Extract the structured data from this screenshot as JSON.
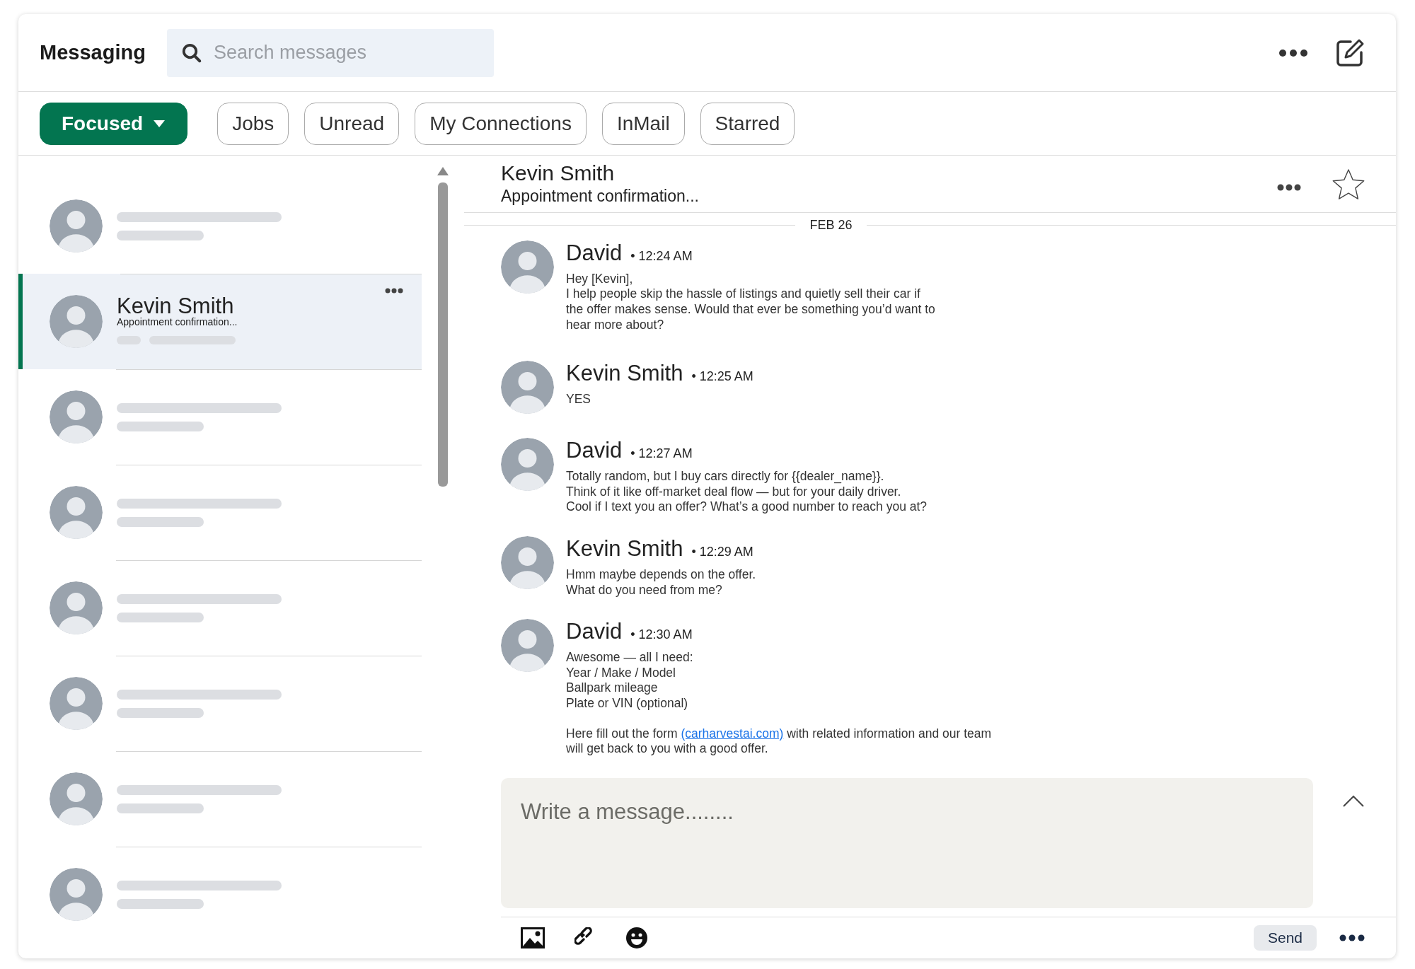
{
  "header": {
    "title": "Messaging",
    "search": {
      "placeholder": "Search messages"
    }
  },
  "filters": [
    {
      "label": "Focused",
      "kind": "dropdown",
      "selected": true
    },
    {
      "label": "Jobs",
      "kind": "pill",
      "selected": false
    },
    {
      "label": "Unread",
      "kind": "pill",
      "selected": false
    },
    {
      "label": "My Connections",
      "kind": "pill",
      "selected": false
    },
    {
      "label": "InMail",
      "kind": "pill",
      "selected": false
    },
    {
      "label": "Starred",
      "kind": "pill",
      "selected": false
    }
  ],
  "conversations": [
    {
      "kind": "placeholder",
      "selected": false
    },
    {
      "kind": "conversation",
      "name": "Kevin Smith",
      "preview": "Appointment confirmation...",
      "selected": true
    },
    {
      "kind": "placeholder",
      "selected": false
    },
    {
      "kind": "placeholder",
      "selected": false
    },
    {
      "kind": "placeholder",
      "selected": false
    },
    {
      "kind": "placeholder",
      "selected": false
    },
    {
      "kind": "placeholder",
      "selected": false
    },
    {
      "kind": "placeholder",
      "selected": false
    }
  ],
  "thread": {
    "name": "Kevin Smith",
    "subtitle": "Appointment confirmation...",
    "starred": false,
    "date": "FEB 26",
    "messages": [
      {
        "author": "David",
        "time": "• 12:24 AM",
        "lines": [
          "Hey [Kevin],",
          "I help people skip the hassle of listings and quietly sell their car if",
          "the offer makes sense. Would that ever be something you’d want to",
          "hear more about?"
        ]
      },
      {
        "author": "Kevin Smith",
        "time": "• 12:25 AM",
        "lines": [
          "YES"
        ]
      },
      {
        "author": "David",
        "time": "• 12:27 AM",
        "lines": [
          "Totally random, but I buy cars directly for {{dealer_name}}.",
          "Think of it like off-market deal flow — but for your daily driver.",
          "Cool if I text you an offer? What’s a good number to reach you at?"
        ]
      },
      {
        "author": "Kevin Smith",
        "time": "• 12:29 AM",
        "lines": [
          "Hmm maybe depends on the offer.",
          "What do you need from me?"
        ]
      },
      {
        "author": "David",
        "time": "• 12:30 AM",
        "lines": [
          "Awesome — all I need:",
          "Year / Make / Model",
          "Ballpark mileage",
          "Plate or VIN (optional)"
        ],
        "footer": {
          "before": "Here fill out the form ",
          "link": "(carharvestai.com)",
          "after": [
            " with related information and our team",
            "will get back to you with a good offer."
          ]
        }
      }
    ]
  },
  "composer": {
    "placeholder": "Write a message........",
    "send": "Send"
  }
}
